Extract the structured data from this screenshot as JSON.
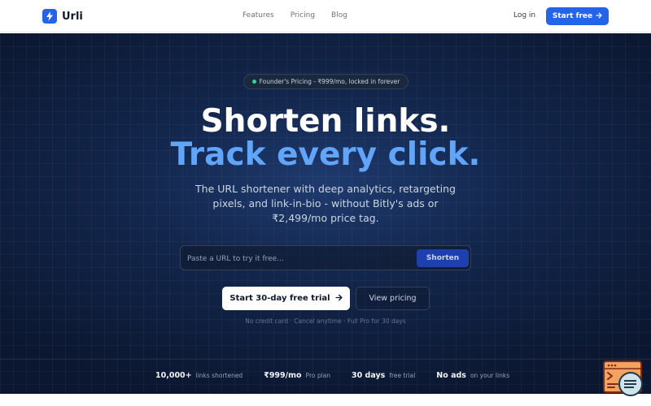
{
  "header": {
    "brand": "Urli",
    "nav": [
      "Features",
      "Pricing",
      "Blog"
    ],
    "login_label": "Log in",
    "cta_label": "Start free",
    "accent_color": "#2563eb"
  },
  "hero": {
    "badge_text": "Founder's Pricing - ₹999/mo, locked in forever",
    "headline_line1": "Shorten links.",
    "headline_line2": "Track every click.",
    "subtitle": "The URL shortener with deep analytics, retargeting pixels, and link-in-bio - without Bitly's ads or ₹2,499/mo price tag.",
    "url_placeholder": "Paste a URL to try it free...",
    "shorten_label": "Shorten",
    "primary_cta": "Start 30-day free trial",
    "secondary_cta": "View pricing",
    "fine_print": "No credit card · Cancel anytime · Full Pro for 30 days",
    "highlight_color": "#60a5fa",
    "badge_dot_color": "#34d399"
  },
  "stats": [
    {
      "value": "10,000+",
      "label": "links shortened"
    },
    {
      "value": "₹999/mo",
      "label": "Pro plan"
    },
    {
      "value": "30 days",
      "label": "free trial"
    },
    {
      "value": "No ads",
      "label": "on your links"
    }
  ],
  "icons": {
    "logo": "lightning-bolt-icon",
    "cta_arrow": "arrow-right-icon",
    "widget": "code-inspect-icon"
  }
}
